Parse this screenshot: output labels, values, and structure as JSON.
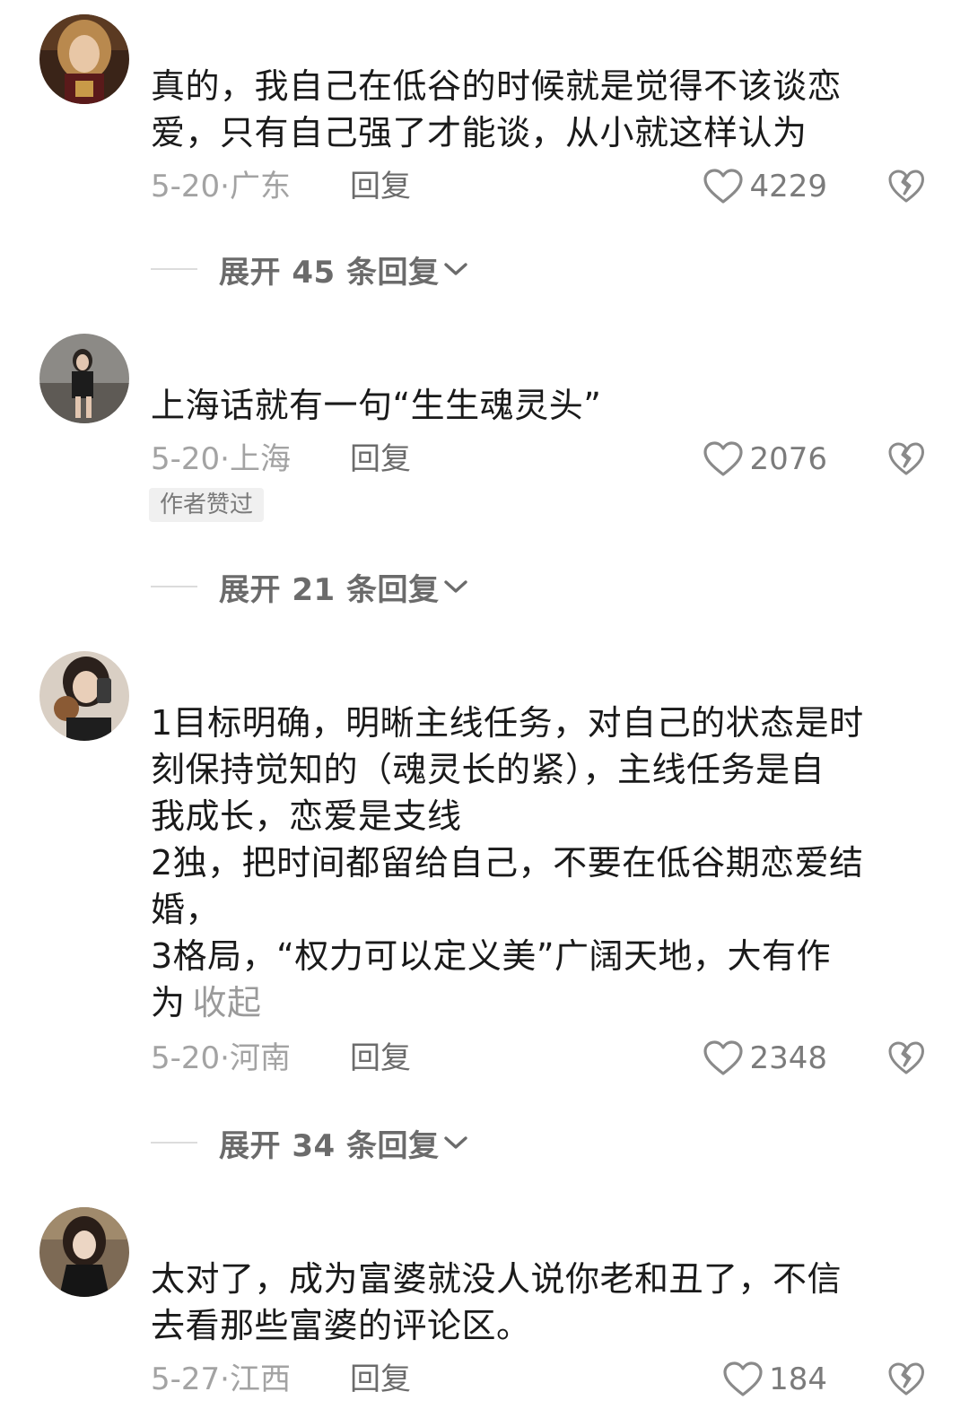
{
  "comments": [
    {
      "lines": [
        "真的，我自己在低谷的时候就是觉得不该谈恋",
        "爱，只有自己强了才能谈，从小就这样认为"
      ],
      "date": "5-20·广东",
      "reply": "回复",
      "likes": "4229",
      "expand": "展开 45 条回复"
    },
    {
      "lines": [
        "上海话就有一句“生生魂灵头”"
      ],
      "date": "5-20·上海",
      "reply": "回复",
      "likes": "2076",
      "badge": "作者赞过",
      "expand": "展开 21 条回复"
    },
    {
      "lines": [
        "1目标明确，明晰主线任务，对自己的状态是时",
        "刻保持觉知的（魂灵长的紧），主线任务是自",
        "我成长，恋爱是支线",
        "2独，把时间都留给自己，不要在低谷期恋爱结",
        "婚，",
        "3格局，“权力可以定义美”广阔天地，大有作",
        "为"
      ],
      "collapse": "收起",
      "date": "5-20·河南",
      "reply": "回复",
      "likes": "2348",
      "expand": "展开 34 条回复"
    },
    {
      "lines": [
        "太对了，成为富婆就没人说你老和丑了，不信",
        "去看那些富婆的评论区。"
      ],
      "date": "5-27·江西",
      "reply": "回复",
      "likes": "184"
    }
  ],
  "icons": {
    "like": "heart-outline-icon",
    "dislike": "broken-heart-icon",
    "expand": "chevron-down-icon"
  },
  "colors": {
    "text": "#1a1a1a",
    "meta": "#a3a3a3",
    "badge_bg": "#f0f0f0"
  }
}
